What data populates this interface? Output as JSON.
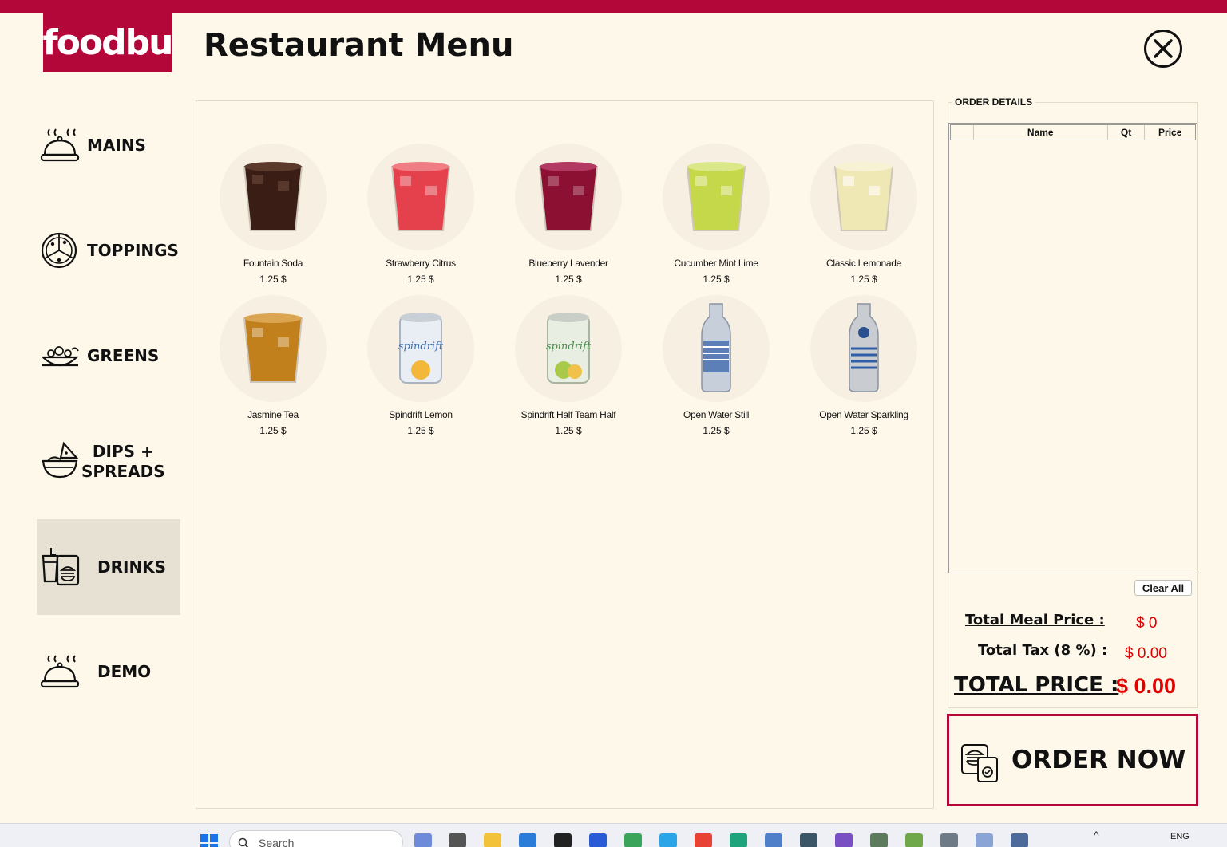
{
  "app": {
    "logo_text": "foodbu",
    "title": "Restaurant Menu"
  },
  "sidebar": {
    "items": [
      {
        "label": "MAINS",
        "icon": "cloche-icon",
        "active": false
      },
      {
        "label": "TOPPINGS",
        "icon": "pizza-icon",
        "active": false
      },
      {
        "label": "GREENS",
        "icon": "salad-bowl-icon",
        "active": false
      },
      {
        "label_line1": "DIPS +",
        "label_line2": "SPREADS",
        "icon": "dip-bowl-icon",
        "active": false
      },
      {
        "label": "DRINKS",
        "icon": "drinks-burger-icon",
        "active": true
      },
      {
        "label": "DEMO",
        "icon": "cloche-icon",
        "active": false
      }
    ]
  },
  "menu": {
    "items": [
      {
        "name": "Fountain Soda",
        "price": "1.25 $",
        "color": "#3a1d14"
      },
      {
        "name": "Strawberry Citrus",
        "price": "1.25 $",
        "color": "#e4414c"
      },
      {
        "name": "Blueberry Lavender",
        "price": "1.25 $",
        "color": "#8b1032"
      },
      {
        "name": "Cucumber Mint Lime",
        "price": "1.25 $",
        "color": "#c5d84a"
      },
      {
        "name": "Classic Lemonade",
        "price": "1.25 $",
        "color": "#efe7b4"
      },
      {
        "name": "Jasmine Tea",
        "price": "1.25 $",
        "color": "#c2801c"
      },
      {
        "name": "Spindrift Lemon",
        "price": "1.25 $",
        "color": "#e9eef5"
      },
      {
        "name": "Spindrift Half Team  Half",
        "price": "1.25 $",
        "color": "#e8efe2"
      },
      {
        "name": "Open Water Still",
        "price": "1.25 $",
        "color": "#c7cfdb"
      },
      {
        "name": "Open Water Sparkling",
        "price": "1.25 $",
        "color": "#c9cdd2"
      }
    ]
  },
  "order": {
    "legend": "ORDER DETAILS",
    "columns": [
      "",
      "Name",
      "Qt",
      "Price"
    ],
    "rows": [],
    "clear_label": "Clear All",
    "meal_price_label": "Total Meal Price :",
    "meal_price_value": "$ 0",
    "tax_label": "Total Tax (8 %) :",
    "tax_value": "$ 0.00",
    "total_label": "TOTAL PRICE :",
    "total_value": "$ 0.00",
    "order_button": "ORDER NOW"
  },
  "taskbar": {
    "search_placeholder": "Search",
    "lang": "ENG"
  },
  "colors": {
    "brand": "#b20738",
    "background": "#fef8ea",
    "active_nav": "#e6e1d3",
    "price_red": "#e00000"
  }
}
